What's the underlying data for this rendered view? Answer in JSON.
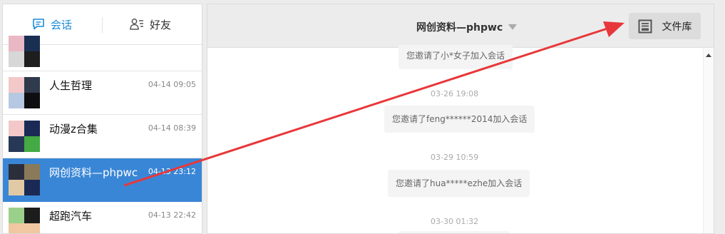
{
  "tabs": [
    {
      "label": "会话",
      "icon": "chat-icon",
      "active": true
    },
    {
      "label": "好友",
      "icon": "friends-icon",
      "active": false
    }
  ],
  "conversations": [
    {
      "name": "",
      "time": "",
      "partial": true,
      "avatar": [
        "#eab8c5",
        "#1b2f52",
        "#d7d7d7",
        "#1e1e1e"
      ]
    },
    {
      "name": "人生哲理",
      "time": "04-14 09:05",
      "avatar": [
        "#f3c8c8",
        "#2f3a4c",
        "#b6c8e2",
        "#0e0e10"
      ]
    },
    {
      "name": "动漫z合集",
      "time": "04-14 08:39",
      "avatar": [
        "#f3c8c8",
        "#1a2a55",
        "#263856",
        "#44aa44"
      ]
    },
    {
      "name": "网创资料—phpwc",
      "time": "04-13 23:12",
      "active": true,
      "avatar": [
        "#2a2f3b",
        "#8a7a5a",
        "#e2c9a5",
        "#1a2a55"
      ]
    },
    {
      "name": "超跑汽车",
      "time": "04-13 22:42",
      "avatar": [
        "#9bd08a",
        "#1c1c1c",
        "#f0c7a0",
        "#f0c7a0"
      ]
    }
  ],
  "chat": {
    "title": "网创资料—phpwc",
    "file_button": "文件库"
  },
  "messages": [
    {
      "kind": "bubble",
      "text": "您邀请了小*女子加入会话"
    },
    {
      "kind": "ts",
      "text": "03-26 19:08"
    },
    {
      "kind": "bubble",
      "text": "您邀请了feng******2014加入会话"
    },
    {
      "kind": "ts",
      "text": "03-29 10:59"
    },
    {
      "kind": "bubble",
      "text": "您邀请了hua*****ezhe加入会话"
    },
    {
      "kind": "ts",
      "text": "03-30 01:32"
    }
  ],
  "colors": {
    "accent": "#1a8ad9",
    "selected": "#3a86d6",
    "annotation_arrow": "#e8373a"
  }
}
